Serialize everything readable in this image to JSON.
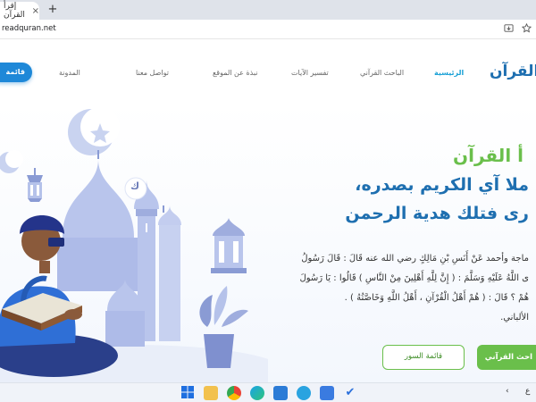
{
  "browser": {
    "tab_title": "إقرأ القرآن",
    "tab_close": "×",
    "new_tab": "+",
    "url": "readquran.net"
  },
  "header": {
    "logo": "أ القرآن",
    "nav": [
      {
        "label": "الرئيسية",
        "active": true
      },
      {
        "label": "الباحث القرآني",
        "active": false
      },
      {
        "label": "تفسير الآيات",
        "active": false
      },
      {
        "label": "نبذة عن الموقع",
        "active": false
      },
      {
        "label": "تواصل معنا",
        "active": false
      },
      {
        "label": "المدونة",
        "active": false
      }
    ],
    "cta": "قائمة"
  },
  "hero": {
    "title_line1": "أ القرآن",
    "title_line2": "ملا آي الكريم بصدره،",
    "title_line3": "رى فتلك هدية الرحمن",
    "hadith_line1": "ماجة وأحمد عَنْ أَنَسِ بْنِ مَالِكٍ رضي الله عنه قَالَ : قَالَ رَسُولُ",
    "hadith_line2": "ى اللَّهُ عَلَيْهِ وَسَلَّمَ : ( إِنَّ لِلَّهِ أَهْلِينَ مِنْ النَّاسِ ) قَالُوا : يَا رَسُولَ",
    "hadith_line3": "هُمْ ؟ قَالَ : ( هُمْ أَهْلُ الْقُرْآنِ ، أَهْلُ اللَّهِ وَخَاصَّتُهُ ) .",
    "hadith_line4": "الألباني.",
    "btn_primary": "احث القرآني",
    "btn_secondary": "قائمة السور"
  },
  "illustration": {
    "badge_letter": "ك"
  },
  "taskbar": {
    "tray_text": "ع"
  },
  "colors": {
    "accent_green": "#6abf4b",
    "accent_blue": "#1e6fb0",
    "nav_active": "#1aa1d6"
  }
}
